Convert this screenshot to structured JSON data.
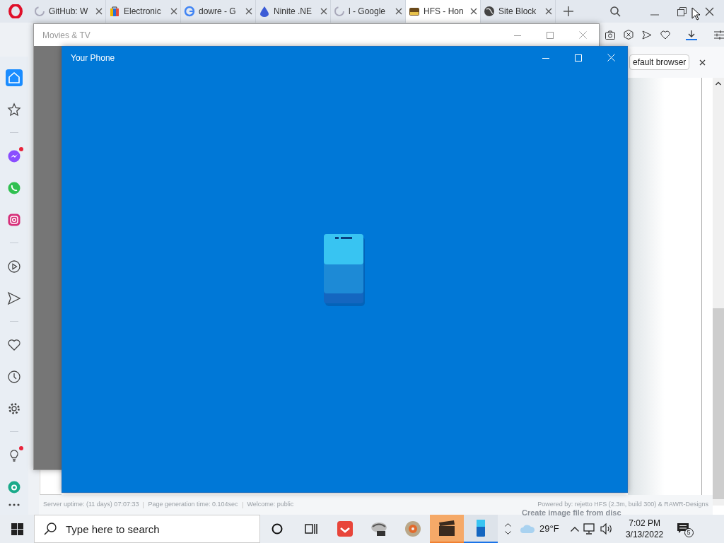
{
  "browser": {
    "tabs": [
      {
        "label": "GitHub: W",
        "kind": "loading",
        "selected": false
      },
      {
        "label": "Electronic",
        "kind": "bag",
        "selected": false
      },
      {
        "label": "dowre - G",
        "kind": "google",
        "selected": false
      },
      {
        "label": "Ninite .NE",
        "kind": "drop",
        "selected": false
      },
      {
        "label": "l - Google",
        "kind": "loading",
        "selected": false
      },
      {
        "label": "HFS - Hon",
        "kind": "hfs",
        "selected": true
      },
      {
        "label": "Site Block",
        "kind": "globe",
        "selected": false
      }
    ],
    "infobar_button": "efault browser",
    "sidebar": [
      {
        "kind": "home",
        "selected": true
      },
      {
        "kind": "star",
        "selected": false
      },
      {
        "kind": "sep"
      },
      {
        "kind": "messenger",
        "selected": false,
        "dot": true
      },
      {
        "kind": "whatsapp",
        "selected": false
      },
      {
        "kind": "instagram",
        "selected": false
      },
      {
        "kind": "sep"
      },
      {
        "kind": "player",
        "selected": false
      },
      {
        "kind": "send",
        "selected": false
      },
      {
        "kind": "sep"
      },
      {
        "kind": "heart",
        "selected": false
      },
      {
        "kind": "clock",
        "selected": false
      },
      {
        "kind": "gear",
        "selected": false
      },
      {
        "kind": "sep"
      },
      {
        "kind": "bulb",
        "selected": false,
        "dot": true
      },
      {
        "kind": "aria",
        "selected": false
      }
    ],
    "status_left": [
      "Server uptime: (11 days) 07:07:33",
      "Page generation time: 0.104sec",
      "Welcome: public"
    ],
    "status_right": "Powered by: rejetto HFS (2.3m, build 300) & RAWR-Designs"
  },
  "windows": [
    {
      "title": "Movies & TV",
      "active": false
    },
    {
      "title": "Your Phone",
      "active": true
    }
  ],
  "ghost_text": "Create image file from disc",
  "taskbar": {
    "search": {
      "placeholder": "Type here to search"
    },
    "apps": [
      {
        "kind": "gom",
        "active": false
      },
      {
        "kind": "pen",
        "active": false
      },
      {
        "kind": "disc",
        "active": false
      },
      {
        "kind": "clapper",
        "active": true
      },
      {
        "kind": "phone",
        "active": true
      }
    ],
    "temperature": "29°F",
    "time": "7:02 PM",
    "date": "3/13/2022",
    "notifications": "5"
  }
}
